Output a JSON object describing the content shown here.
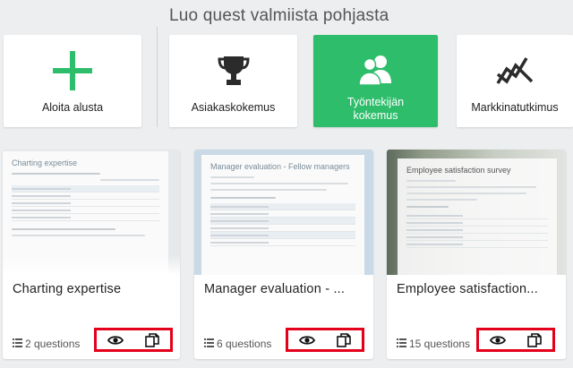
{
  "heading": "Luo quest valmiista pohjasta",
  "tiles": [
    {
      "label": "Aloita alusta",
      "icon": "plus-icon"
    },
    {
      "label": "Asiakaskokemus",
      "icon": "trophy-icon"
    },
    {
      "label_line1": "Työntekijän",
      "label_line2": "kokemus",
      "icon": "users-icon",
      "active": true
    },
    {
      "label": "Markkinatutkimus",
      "icon": "trend-icon"
    }
  ],
  "cards": [
    {
      "title": "Charting expertise",
      "questions": "2 questions",
      "preview_title": "Charting expertise"
    },
    {
      "title": "Manager evaluation - ...",
      "questions": "6 questions",
      "preview_title": "Manager evaluation - Fellow managers"
    },
    {
      "title": "Employee satisfaction...",
      "questions": "15 questions",
      "preview_title": "Employee satisfaction survey"
    }
  ],
  "colors": {
    "accent_green": "#2ebd6b",
    "highlight_red": "#e3001b",
    "background": "#eceeef"
  }
}
